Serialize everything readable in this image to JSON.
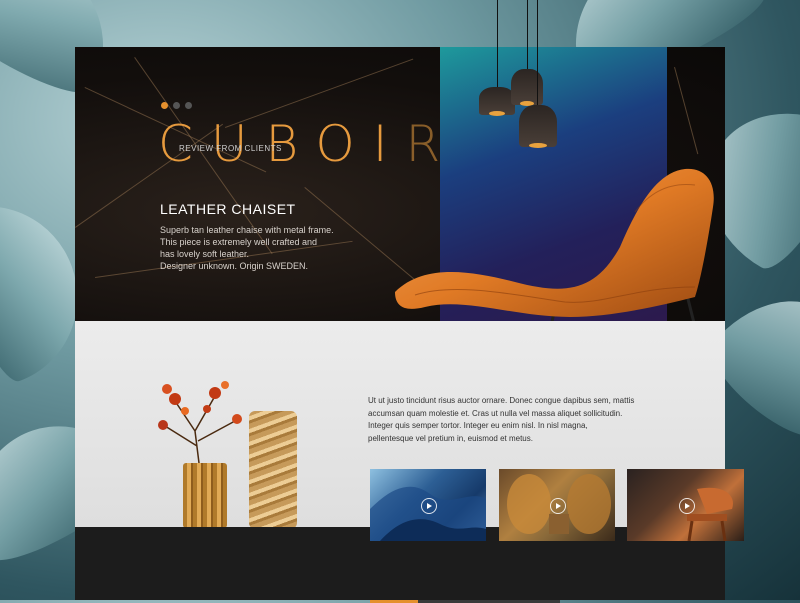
{
  "brand": {
    "name_solid": "CUBOI",
    "name_faded": "R"
  },
  "slider": {
    "dots": 3,
    "active_index": 0,
    "accent": "#e5902d"
  },
  "product": {
    "title": "LEATHER CHAISET",
    "description_lines": [
      "Superb tan leather chaise with metal frame.",
      "This piece is extremely well crafted and",
      "has lovely soft leather.",
      "Designer unknown. Origin SWEDEN."
    ]
  },
  "about": {
    "text_lines": [
      "Ut ut justo tincidunt risus auctor ornare. Donec congue dapibus sem, mattis",
      "accumsan quam molestie et. Cras ut nulla vel massa aliquet sollicitudin.",
      "Integer quis semper tortor. Integer eu enim nisl. In nisl magna,",
      "pellentesque vel pretium in, euismod et metus."
    ]
  },
  "gallery": {
    "videos": [
      {
        "icon": "play-icon",
        "subject": "marble cave"
      },
      {
        "icon": "play-icon",
        "subject": "wicker chairs"
      },
      {
        "icon": "play-icon",
        "subject": "wooden chair"
      }
    ],
    "progress_fraction": 0.25
  },
  "footer": {
    "review_heading": "REVIEW FROM CLIENTS"
  }
}
